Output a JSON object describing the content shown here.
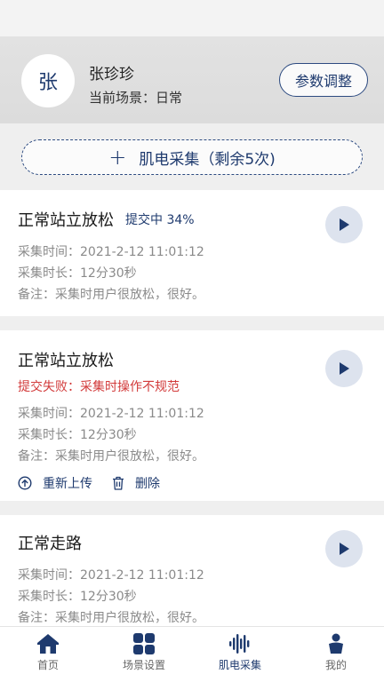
{
  "profile": {
    "avatar_char": "张",
    "name": "张珍珍",
    "scene_label": "当前场景：",
    "scene_value": "日常",
    "param_button": "参数调整"
  },
  "add_button": {
    "label": "肌电采集（剩余5次)"
  },
  "records": [
    {
      "title": "正常站立放松",
      "status": "提交中 34%",
      "time": "采集时间：2021-2-12 11:01:12",
      "duration": "采集时长：12分30秒",
      "note": "备注：采集时用户很放松，很好。"
    },
    {
      "title": "正常站立放松",
      "error": "提交失败：采集时操作不规范",
      "time": "采集时间：2021-2-12 11:01:12",
      "duration": "采集时长：12分30秒",
      "note": "备注：采集时用户很放松，很好。",
      "actions": {
        "reupload": "重新上传",
        "delete": "删除"
      }
    },
    {
      "title": "正常走路",
      "time": "采集时间：2021-2-12 11:01:12",
      "duration": "采集时长：12分30秒",
      "note": "备注：采集时用户很放松，很好。"
    }
  ],
  "nav": {
    "items": [
      {
        "label": "首页",
        "icon": "home-icon"
      },
      {
        "label": "场景设置",
        "icon": "grid-icon"
      },
      {
        "label": "肌电采集",
        "icon": "waveform-icon",
        "active": true
      },
      {
        "label": "我的",
        "icon": "person-icon"
      }
    ]
  },
  "colors": {
    "accent": "#1e3a6e",
    "error": "#d23a3a",
    "muted": "#8a8a8a"
  }
}
